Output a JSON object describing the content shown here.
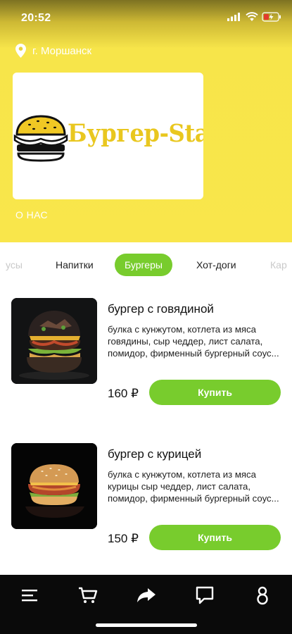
{
  "status_bar": {
    "time": "20:52"
  },
  "location": {
    "city": "г. Моршанск"
  },
  "brand": {
    "logo_text": "Бургер-Star",
    "about_label": "О НАС"
  },
  "categories": [
    {
      "label": "усы"
    },
    {
      "label": "Напитки"
    },
    {
      "label": "Бургеры"
    },
    {
      "label": "Хот-доги"
    },
    {
      "label": "Кар"
    }
  ],
  "products": [
    {
      "title": "бургер с говядиной",
      "description": "булка с кунжутом, котлета из мяса говядины, сыр чеддер, лист салата, помидор, фирменный бургерный соус...",
      "price": "160 ₽",
      "button": "Купить"
    },
    {
      "title": "бургер с курицей",
      "description": "булка с кунжутом, котлета из мяса курицы сыр чеддер, лист салата, помидор, фирменный бургерный соус...",
      "price": "150 ₽",
      "button": "Купить"
    }
  ],
  "bottom_nav": [
    "menu-icon",
    "cart-icon",
    "share-icon",
    "chat-icon",
    "profile-icon"
  ],
  "colors": {
    "accent": "#78cc2d",
    "header": "#f9e64b",
    "nav": "#0a0a0a"
  }
}
